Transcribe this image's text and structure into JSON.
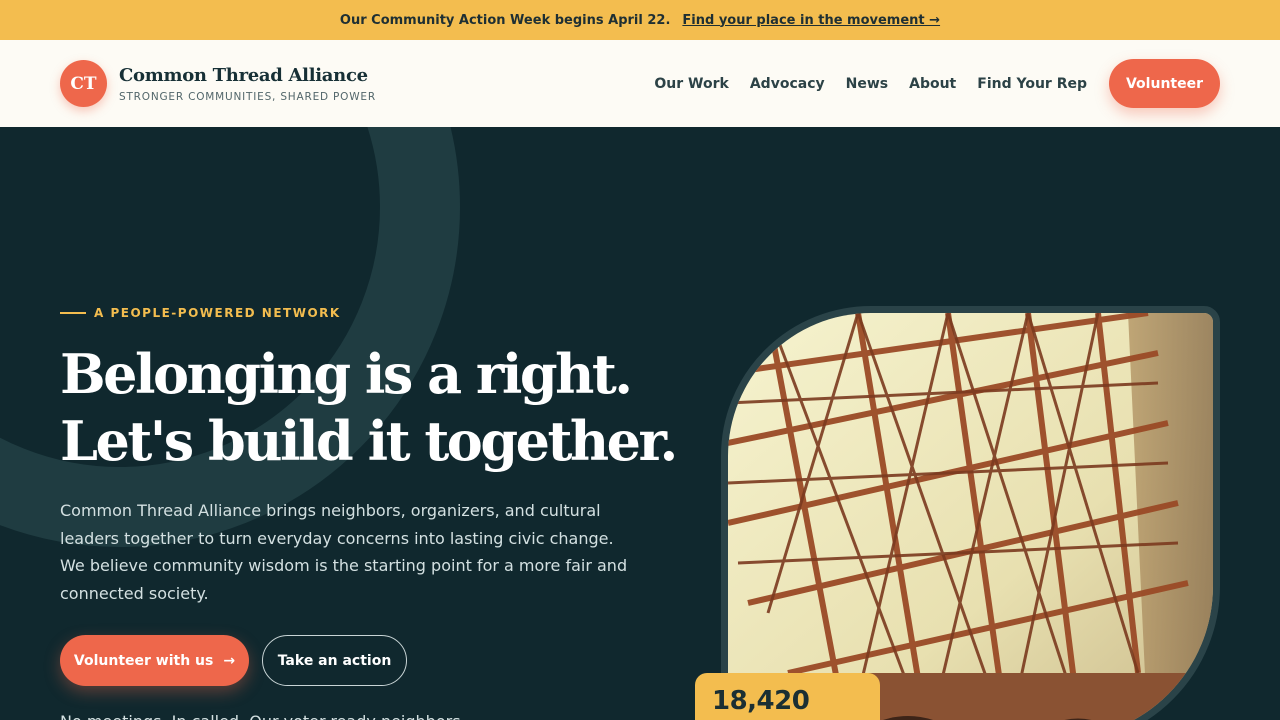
{
  "announcement": {
    "text": "Our Community Action Week begins April 22.",
    "link": "Find your place in the movement →"
  },
  "header": {
    "logo_text": "CT",
    "brand_name": "Common Thread Alliance",
    "tagline": "STRONGER COMMUNITIES, SHARED POWER",
    "nav": [
      {
        "label": "Our Work"
      },
      {
        "label": "Advocacy"
      },
      {
        "label": "News"
      },
      {
        "label": "About"
      },
      {
        "label": "Find Your Rep"
      }
    ],
    "cta": "Volunteer"
  },
  "hero": {
    "eyebrow": "A PEOPLE-POWERED NETWORK",
    "headline_line1": "Belonging is a right.",
    "headline_line2": "Let's build it together.",
    "intro": "Common Thread Alliance brings neighbors, organizers, and cultural leaders together to turn everyday concerns into lasting civic change. We believe community wisdom is the starting point for a more fair and connected society.",
    "primary_cta": "Volunteer with us",
    "primary_cta_arrow": "→",
    "secondary_cta": "Take an action",
    "note_partial": "No meetings. In called. Our voter-ready neighbors"
  },
  "stat": {
    "value": "18,420"
  },
  "colors": {
    "accent": "#ee674b",
    "announcement": "#f3bd4f",
    "hero_bg": "#10282e",
    "header_bg": "#fdfbf5"
  }
}
